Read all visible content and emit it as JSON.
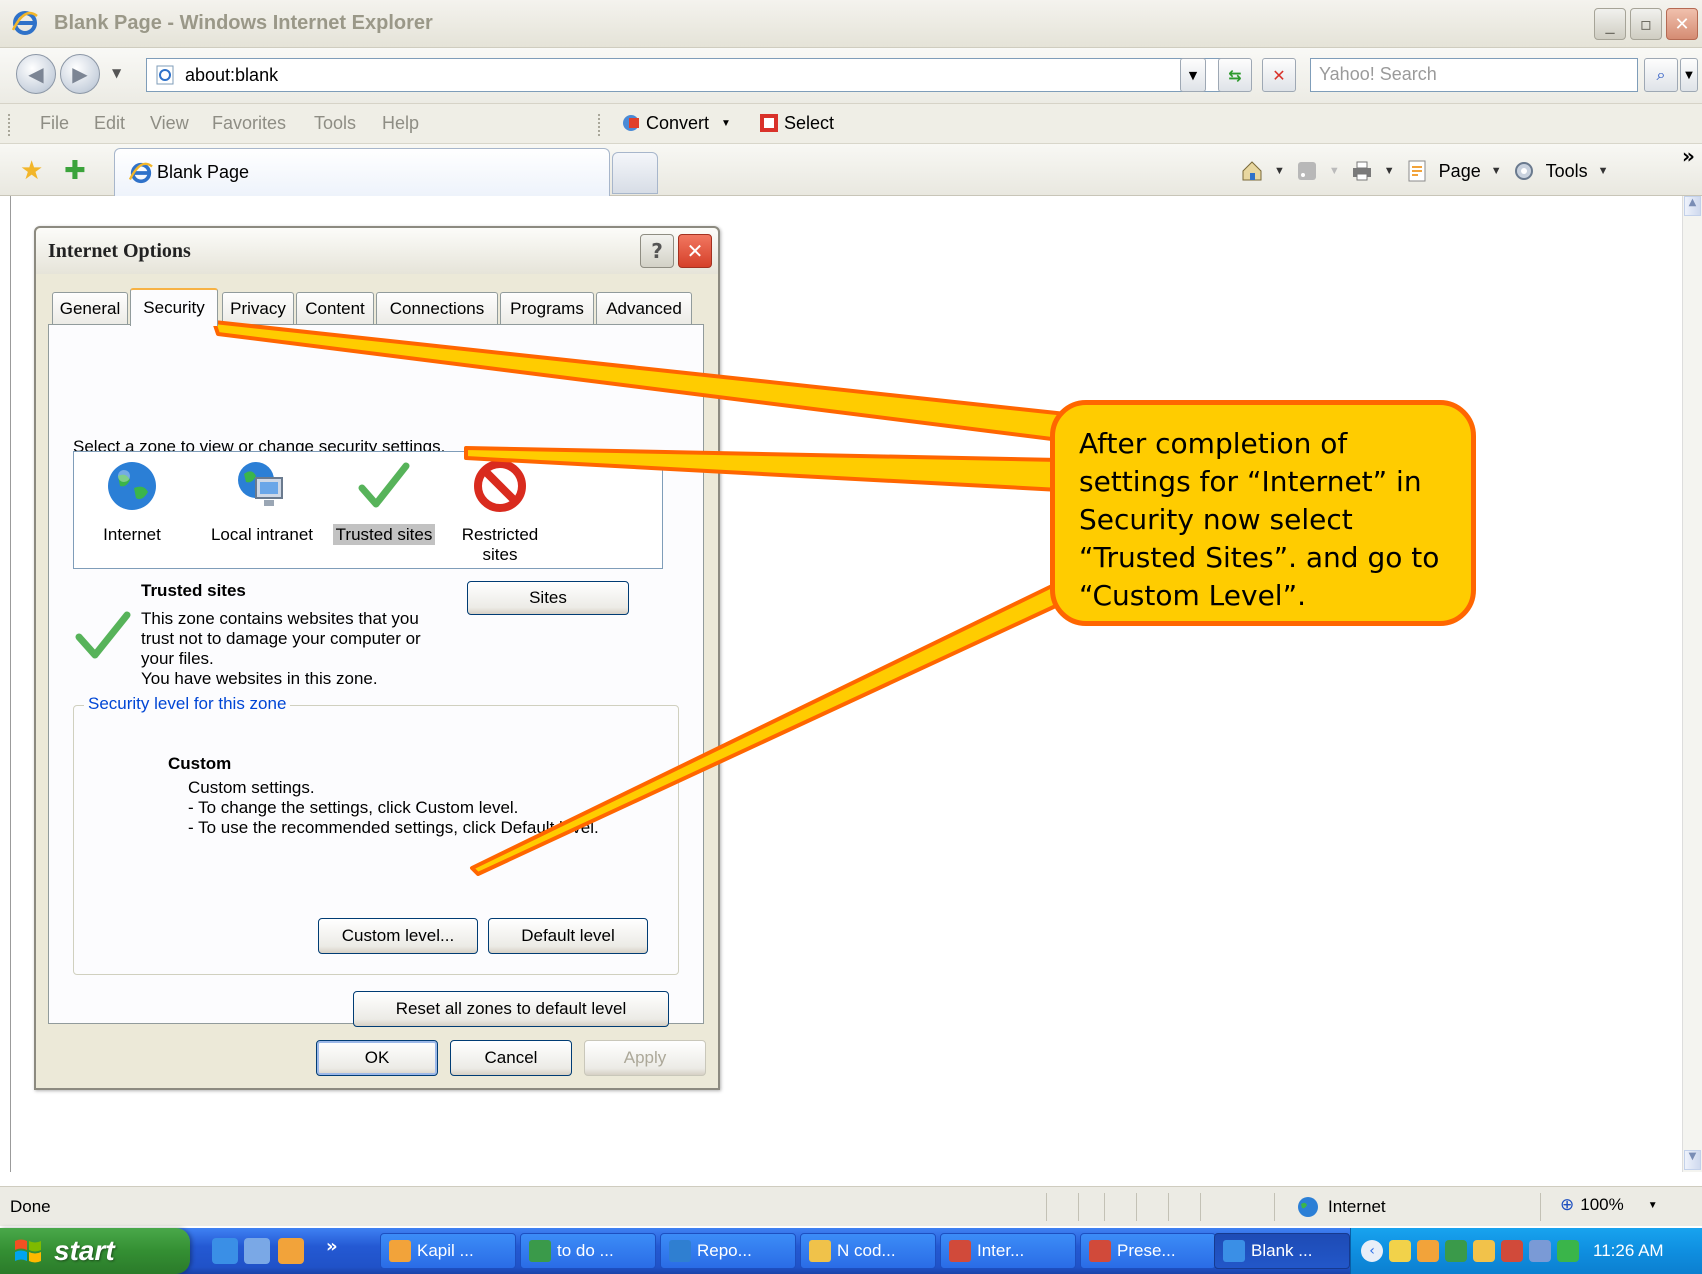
{
  "window": {
    "title": "Blank Page - Windows Internet Explorer",
    "minimize": "_",
    "restore": "▫",
    "close": "✕"
  },
  "address_bar": {
    "url": "about:blank",
    "search_placeholder": "Yahoo! Search"
  },
  "menu": {
    "items": [
      "File",
      "Edit",
      "View",
      "Favorites",
      "Tools",
      "Help"
    ],
    "convert_label": "Convert",
    "select_label": "Select"
  },
  "tabs": {
    "active_tab_label": "Blank Page"
  },
  "command_bar": {
    "page_label": "Page",
    "tools_label": "Tools",
    "overflow": "»"
  },
  "dialog": {
    "title": "Internet Options",
    "help": "?",
    "close": "✕",
    "tabs": [
      "General",
      "Security",
      "Privacy",
      "Content",
      "Connections",
      "Programs",
      "Advanced"
    ],
    "selected_tab": "Security",
    "zone_prompt": "Select a zone to view or change security settings.",
    "zones": [
      {
        "label": "Internet",
        "icon": "globe-icon"
      },
      {
        "label": "Local intranet",
        "icon": "intranet-icon"
      },
      {
        "label": "Trusted sites",
        "icon": "checkmark-icon"
      },
      {
        "label": "Restricted sites",
        "icon": "restricted-icon"
      }
    ],
    "selected_zone": "Trusted sites",
    "zone_info": {
      "title": "Trusted sites",
      "lines": [
        "This zone contains websites that you",
        "trust not to damage your computer or",
        "your files.",
        "You have websites in this zone."
      ],
      "sites_button": "Sites"
    },
    "security_level": {
      "legend": "Security level for this zone",
      "level_name": "Custom",
      "lines": [
        "Custom settings.",
        "- To change the settings, click Custom level.",
        "- To use the recommended settings, click Default level."
      ],
      "custom_level_button": "Custom level...",
      "default_level_button": "Default level"
    },
    "reset_button": "Reset all zones to default level",
    "ok_button": "OK",
    "cancel_button": "Cancel",
    "apply_button": "Apply"
  },
  "callout": {
    "text": "After completion of settings for “Internet” in Security now select “Trusted Sites”. and go to “Custom Level”."
  },
  "status_bar": {
    "status": "Done",
    "zone": "Internet",
    "zoom": "100%"
  },
  "taskbar": {
    "start_label": "start",
    "quicklaunch_overflow": "»",
    "buttons": [
      {
        "label": "Kapil ...",
        "color": "#f2a33a"
      },
      {
        "label": "to do ...",
        "color": "#3a9a4a"
      },
      {
        "label": "Repo...",
        "color": "#2f7fd1"
      },
      {
        "label": "N cod...",
        "color": "#f0c24a"
      },
      {
        "label": "Inter...",
        "color": "#d14a3a"
      },
      {
        "label": "Prese...",
        "color": "#d14a3a"
      },
      {
        "label": "Blank ...",
        "color": "#3a8fe6"
      }
    ],
    "clock": "11:26 AM"
  }
}
